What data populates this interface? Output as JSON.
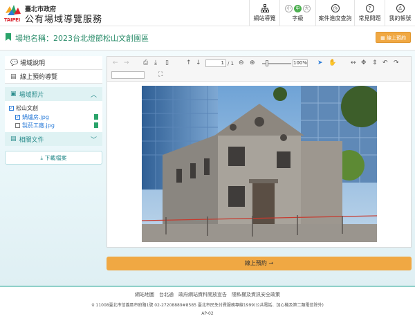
{
  "header": {
    "logo_text": "TAIPEI",
    "gov_label": "臺北市政府",
    "site_name": "公有場域導覽服務",
    "nav": [
      {
        "label": "網站導覽",
        "icon": "sitemap-icon"
      },
      {
        "label": "字級",
        "icon": "font-size-icon"
      },
      {
        "label": "案件進度查詢",
        "icon": "clock-icon"
      },
      {
        "label": "常見問題",
        "icon": "question-icon"
      },
      {
        "label": "我的帳號",
        "icon": "user-icon"
      }
    ],
    "font_sizes": [
      "小",
      "中",
      "大"
    ],
    "font_size_selected": "中"
  },
  "title_row": {
    "label": "場地名稱：2023台北燈節松山文創園區",
    "online_button": "線上預約"
  },
  "sidebar": {
    "items": [
      {
        "label": "場域說明",
        "icon": "comment-icon"
      },
      {
        "label": "線上預約導覽",
        "icon": "file-icon"
      }
    ],
    "photos_section": {
      "label": "場域照片",
      "venue": "松山文創",
      "files": [
        {
          "name": "鍋爐房.jpg",
          "checked": true
        },
        {
          "name": "製菸工廠.jpg",
          "checked": false
        }
      ]
    },
    "docs_section": {
      "label": "相關文件"
    },
    "download_button": "下載檔案"
  },
  "viewer": {
    "page_indicator": "1",
    "page_total": "/ 1",
    "zoom": "100%"
  },
  "cta": "線上預約 →",
  "footer": {
    "links": [
      "網站地圖",
      "台北通",
      "政府網站資料開放宣告",
      "隱私權及資訊安全政策"
    ],
    "address": "11008臺北市信義區市府路1號  02-27208889#8585  臺北市民免付費服務專線1999(公共電話、加心機及第二類電信除外)",
    "code": "AP-02"
  },
  "colors": {
    "accent": "#2a8c6a",
    "button": "#f0a843",
    "link": "#2a7bd8"
  }
}
